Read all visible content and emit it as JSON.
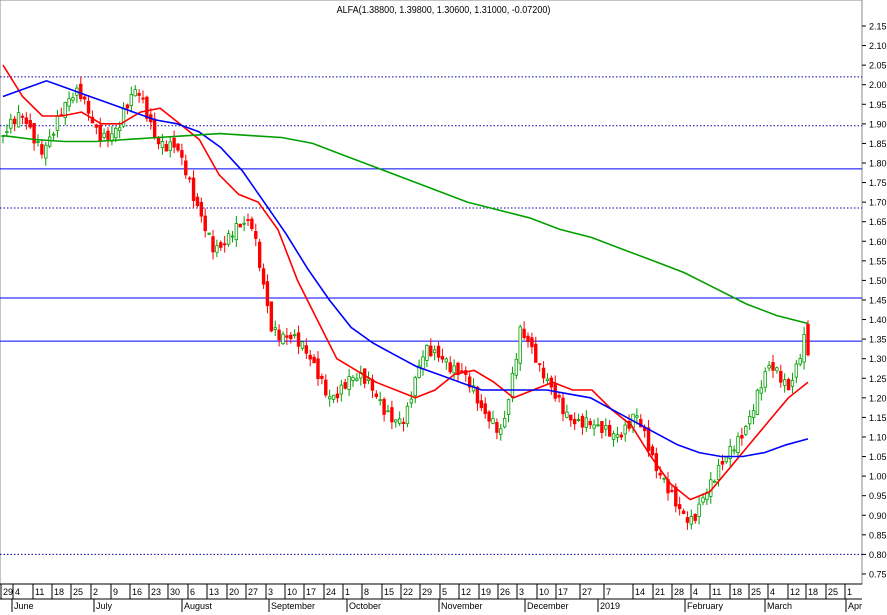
{
  "chart_data": {
    "type": "candlestick",
    "title": "ALFA(1.38800, 1.39800, 1.30600, 1.31000, -0.07200)",
    "symbol": "ALFA",
    "last_bar": {
      "open": 1.388,
      "high": 1.398,
      "low": 1.306,
      "close": 1.31,
      "change": -0.072
    },
    "ylim": [
      0.75,
      2.15
    ],
    "y_ticks": [
      "2.15",
      "2.10",
      "2.05",
      "2.00",
      "1.95",
      "1.90",
      "1.85",
      "1.80",
      "1.75",
      "1.70",
      "1.65",
      "1.60",
      "1.55",
      "1.50",
      "1.45",
      "1.40",
      "1.35",
      "1.30",
      "1.25",
      "1.20",
      "1.15",
      "1.10",
      "1.05",
      "1.00",
      "0.95",
      "0.90",
      "0.85",
      "0.80",
      "0.75"
    ],
    "x_day_labels": [
      "29",
      "4",
      "11",
      "18",
      "25",
      "2",
      "9",
      "16",
      "23",
      "30",
      "6",
      "13",
      "20",
      "27",
      "3",
      "10",
      "17",
      "24",
      "1",
      "8",
      "15",
      "22",
      "29",
      "5",
      "12",
      "19",
      "26",
      "3",
      "10",
      "17",
      "27",
      "7",
      "14",
      "21",
      "28",
      "4",
      "11",
      "18",
      "25",
      "4",
      "12",
      "18",
      "25",
      "1"
    ],
    "x_month_labels": [
      "June",
      "July",
      "August",
      "September",
      "October",
      "November",
      "December",
      "2019",
      "February",
      "March",
      "Apr"
    ],
    "weekly_close": [
      1.87,
      1.9,
      1.85,
      1.93,
      1.96,
      1.89,
      1.89,
      1.97,
      1.88,
      1.85,
      1.68,
      1.6,
      1.63,
      1.62,
      1.4,
      1.36,
      1.28,
      1.22,
      1.25,
      1.22,
      1.18,
      1.15,
      1.3,
      1.32,
      1.27,
      1.14,
      1.13,
      1.38,
      1.25,
      1.21,
      1.14,
      1.1,
      1.12,
      1.17,
      1.0,
      0.96,
      0.89,
      0.96,
      1.09,
      1.16,
      1.26,
      1.24,
      1.4
    ],
    "series": [
      {
        "name": "MA short",
        "color": "#ff0000",
        "values": [
          2.05,
          1.97,
          1.92,
          1.92,
          1.93,
          1.9,
          1.9,
          1.93,
          1.94,
          1.9,
          1.86,
          1.77,
          1.72,
          1.7,
          1.63,
          1.5,
          1.4,
          1.3,
          1.27,
          1.24,
          1.22,
          1.2,
          1.22,
          1.26,
          1.27,
          1.24,
          1.2,
          1.22,
          1.24,
          1.22,
          1.22,
          1.17,
          1.13,
          1.05,
          0.98,
          0.94,
          0.96,
          1.02,
          1.08,
          1.14,
          1.2,
          1.24
        ]
      },
      {
        "name": "MA medium",
        "color": "#0000ff",
        "values": [
          1.97,
          1.99,
          2.01,
          1.99,
          1.97,
          1.95,
          1.93,
          1.91,
          1.9,
          1.88,
          1.84,
          1.78,
          1.7,
          1.62,
          1.53,
          1.45,
          1.38,
          1.34,
          1.31,
          1.28,
          1.26,
          1.24,
          1.22,
          1.22,
          1.22,
          1.22,
          1.21,
          1.2,
          1.17,
          1.14,
          1.11,
          1.08,
          1.06,
          1.05,
          1.05,
          1.06,
          1.08,
          1.095
        ]
      },
      {
        "name": "MA long",
        "color": "#00a000",
        "values": [
          1.87,
          1.86,
          1.855,
          1.855,
          1.86,
          1.865,
          1.87,
          1.875,
          1.87,
          1.865,
          1.85,
          1.82,
          1.79,
          1.76,
          1.73,
          1.7,
          1.68,
          1.66,
          1.63,
          1.61,
          1.58,
          1.55,
          1.52,
          1.48,
          1.44,
          1.41,
          1.39
        ]
      }
    ],
    "horizontal_lines": [
      {
        "value": 2.02,
        "style": "dotted",
        "color": "#0000aa"
      },
      {
        "value": 1.895,
        "style": "dotted",
        "color": "#0000aa"
      },
      {
        "value": 1.785,
        "style": "solid",
        "color": "#0000ff"
      },
      {
        "value": 1.685,
        "style": "dotted",
        "color": "#0000aa"
      },
      {
        "value": 1.455,
        "style": "solid",
        "color": "#0000ff"
      },
      {
        "value": 1.345,
        "style": "solid",
        "color": "#0000ff"
      },
      {
        "value": 0.8,
        "style": "dotted",
        "color": "#0000aa"
      }
    ],
    "up_color": "#00a000",
    "down_color": "#ff0000"
  }
}
